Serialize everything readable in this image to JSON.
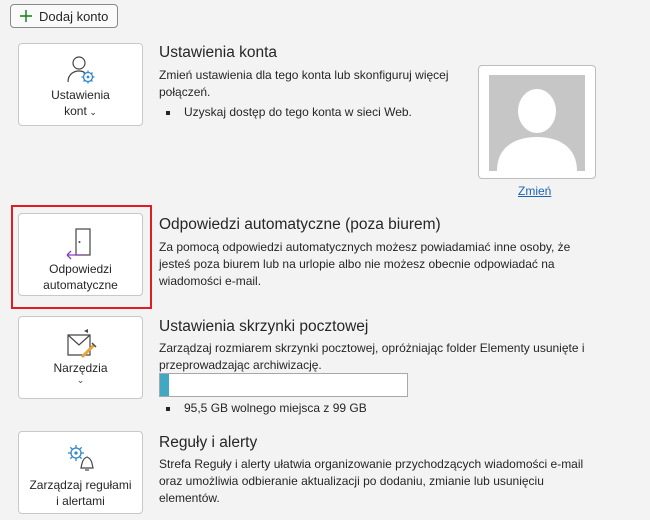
{
  "toolbar": {
    "add_account_label": "Dodaj konto"
  },
  "account_settings": {
    "tile_label": "Ustawienia konta",
    "tile_label_line1": "Ustawienia",
    "tile_label_line2": "kont",
    "title": "Ustawienia konta",
    "description": "Zmień ustawienia dla tego konta lub skonfiguruj więcej połączeń.",
    "bullet": "Uzyskaj dostęp do tego konta w sieci Web.",
    "photo_change_link": "Zmień"
  },
  "auto_replies": {
    "tile_label_line1": "Odpowiedzi",
    "tile_label_line2": "automatyczne",
    "title": "Odpowiedzi automatyczne (poza biurem)",
    "description": "Za pomocą odpowiedzi automatycznych możesz powiadamiać inne osoby, że jesteś poza biurem lub na urlopie albo nie możesz obecnie odpowiadać na wiadomości e-mail."
  },
  "mailbox_settings": {
    "tile_label": "Narzędzia",
    "title": "Ustawienia skrzynki pocztowej",
    "description": "Zarządzaj rozmiarem skrzynki pocztowej, opróżniając folder Elementy usunięte i przeprowadzając archiwizację.",
    "quota_fraction": 0.035,
    "quota_text": "95,5 GB wolnego miejsca z 99 GB"
  },
  "rules_alerts": {
    "tile_label_line1": "Zarządzaj regułami",
    "tile_label_line2": "i alertami",
    "title": "Reguły i alerty",
    "description": "Strefa Reguły i alerty ułatwia organizowanie przychodzących wiadomości e-mail oraz umożliwia odbieranie aktualizacji po dodaniu, zmianie lub usunięciu elementów."
  },
  "colors": {
    "accent_green": "#107c10",
    "accent_purple": "#8b3fbf",
    "highlight_red": "#e21c24",
    "link_blue": "#1a64b8",
    "quota_fill": "#41a7c3"
  },
  "icons": [
    "plus-icon",
    "person-gear-icon",
    "door-arrow-icon",
    "mail-tools-icon",
    "gear-bell-icon",
    "person-silhouette-icon"
  ]
}
